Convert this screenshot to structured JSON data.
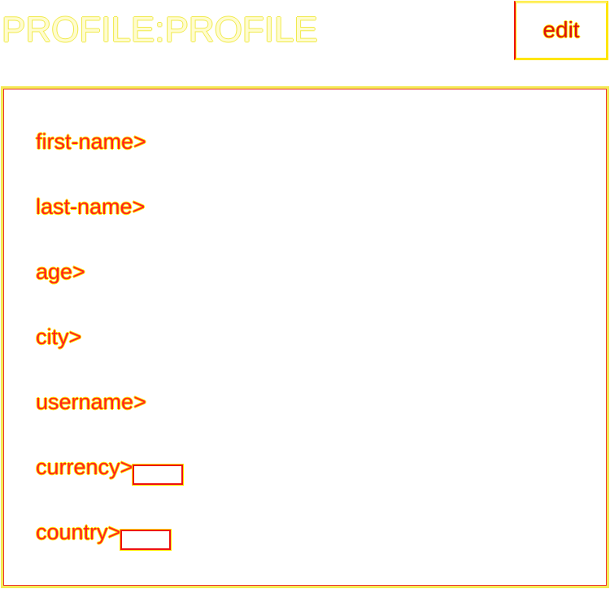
{
  "header": {
    "title": "PROFILE:PROFILE",
    "edit_label": "edit"
  },
  "fields": [
    {
      "label": "first-name>",
      "value": ""
    },
    {
      "label": "last-name>",
      "value": ""
    },
    {
      "label": "age>",
      "value": ""
    },
    {
      "label": "city>",
      "value": ""
    },
    {
      "label": "username>",
      "value": ""
    },
    {
      "label": "currency>",
      "value": ""
    },
    {
      "label": "country>",
      "value": ""
    }
  ],
  "colors": {
    "outline_red": "#ee1111",
    "outline_yellow": "#ffe600",
    "background": "#ffffff"
  }
}
